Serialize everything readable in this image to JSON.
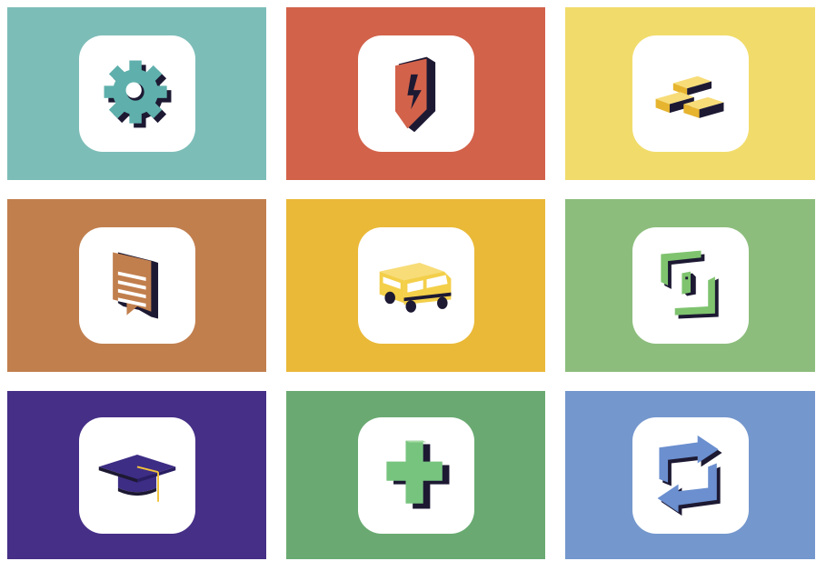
{
  "tiles": [
    {
      "icon": "gear-icon",
      "bg": "#7dbdb8",
      "accent": "#5fb0ac"
    },
    {
      "icon": "lightning-shield-icon",
      "bg": "#d2624a",
      "accent": "#d2624a"
    },
    {
      "icon": "gold-bars-icon",
      "bg": "#f1dc6b",
      "accent": "#f2d24a"
    },
    {
      "icon": "message-board-icon",
      "bg": "#c17f4e",
      "accent": "#c17f4e"
    },
    {
      "icon": "bus-icon",
      "bg": "#eab938",
      "accent": "#f3cf4a"
    },
    {
      "icon": "bracket-frame-icon",
      "bg": "#8cbd7c",
      "accent": "#7fc36f"
    },
    {
      "icon": "graduation-cap-icon",
      "bg": "#462f87",
      "accent": "#3e2d85"
    },
    {
      "icon": "medical-cross-icon",
      "bg": "#6aaa72",
      "accent": "#77c47f"
    },
    {
      "icon": "refresh-arrows-icon",
      "bg": "#7497cd",
      "accent": "#6b8fcf"
    }
  ],
  "colors": {
    "shadow": "#1d1933",
    "card": "#ffffff",
    "tassel": "#f2c23a"
  }
}
